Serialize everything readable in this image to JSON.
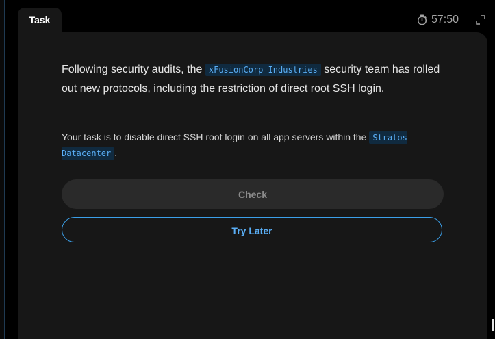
{
  "tab": {
    "label": "Task"
  },
  "timer": {
    "value": "57:50",
    "icon": "stopwatch-icon"
  },
  "task": {
    "intro_before": "Following security audits, the ",
    "intro_code": "xFusionCorp Industries",
    "intro_after": " security team has rolled out new protocols, including the restriction of direct root SSH login.",
    "instruction_before": "Your task is to disable direct SSH root login on all app servers within the ",
    "instruction_code": "Stratos Datacenter",
    "instruction_after": "."
  },
  "buttons": {
    "check": "Check",
    "try_later": "Try Later"
  },
  "colors": {
    "background": "#000000",
    "panel": "#171717",
    "accent": "#3b9fe8",
    "code_bg": "#102a3f"
  }
}
